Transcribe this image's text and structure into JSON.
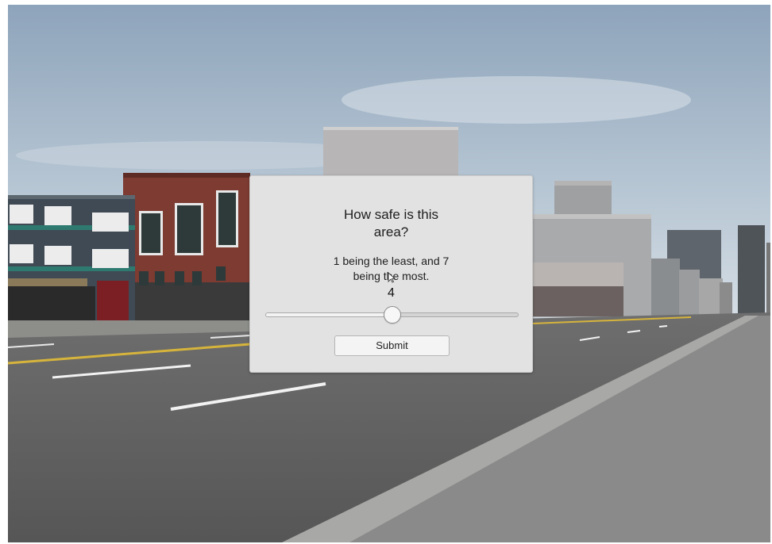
{
  "survey_dialog": {
    "question": "How safe is this area?",
    "instruction": "1 being the least, and 7 being the most.",
    "rating": {
      "min": 1,
      "max": 7,
      "value": 4,
      "display": "4"
    },
    "submit_label": "Submit"
  },
  "scene": {
    "sky_color_top": "#8fa6bd",
    "sky_color_bottom": "#d2dce4",
    "road_color": "#5d5d5d",
    "sidewalk_color": "#8f8f8f",
    "lane_marking_color": "#f2f2f2",
    "center_line_color": "#d6b43c"
  }
}
